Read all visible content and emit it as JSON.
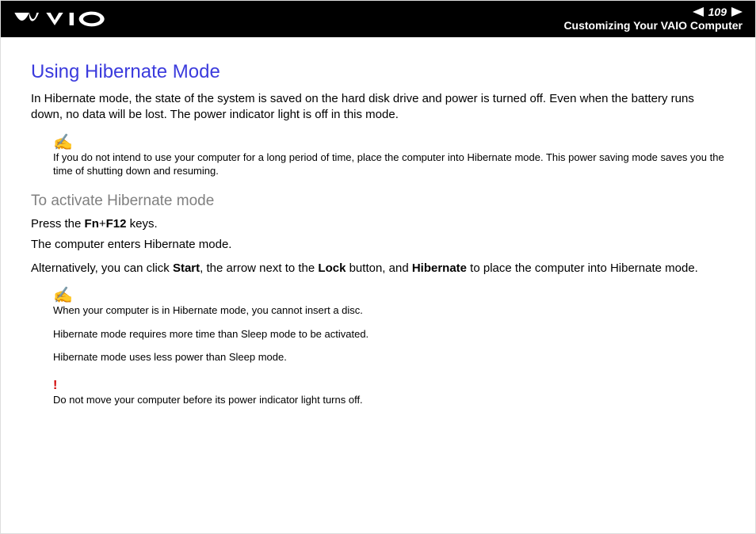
{
  "header": {
    "page_number": "109",
    "breadcrumb": "Customizing Your VAIO Computer"
  },
  "main": {
    "title": "Using Hibernate Mode",
    "intro": "In Hibernate mode, the state of the system is saved on the hard disk drive and power is turned off. Even when the battery runs down, no data will be lost. The power indicator light is off in this mode.",
    "note1": "If you do not intend to use your computer for a long period of time, place the computer into Hibernate mode. This power saving mode saves you the time of shutting down and resuming.",
    "subheading": "To activate Hibernate mode",
    "press_prefix": "Press the ",
    "press_keys": "Fn",
    "press_plus": "+",
    "press_keys2": "F12",
    "press_suffix": " keys.",
    "enters": "The computer enters Hibernate mode.",
    "alt_prefix": "Alternatively, you can click ",
    "alt_start": "Start",
    "alt_mid1": ", the arrow next to the ",
    "alt_lock": "Lock",
    "alt_mid2": " button, and ",
    "alt_hibernate": "Hibernate",
    "alt_suffix": " to place the computer into Hibernate mode.",
    "note2a": "When your computer is in Hibernate mode, you cannot insert a disc.",
    "note2b": "Hibernate mode requires more time than Sleep mode to be activated.",
    "note2c": "Hibernate mode uses less power than Sleep mode.",
    "warn": "Do not move your computer before its power indicator light turns off."
  }
}
